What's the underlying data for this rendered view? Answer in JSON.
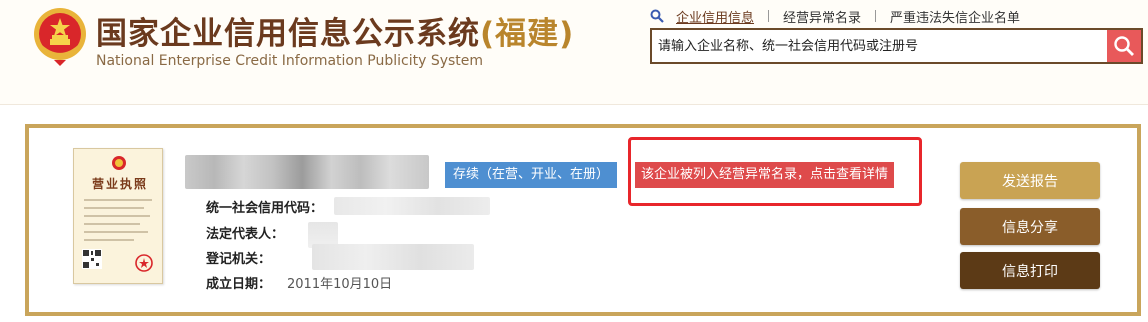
{
  "header": {
    "title_cn": "国家企业信用信息公示系统",
    "province": "(福建)",
    "title_en": "National Enterprise Credit Information Publicity System"
  },
  "nav": {
    "items": [
      "企业信用信息",
      "经营异常名录",
      "严重违法失信企业名单"
    ]
  },
  "search": {
    "placeholder": "请输入企业名称、统一社会信用代码或注册号"
  },
  "result": {
    "license_title": "营业执照",
    "status": "存续（在营、开业、在册）",
    "abnormal_notice": "该企业被列入经营异常名录，点击查看详情",
    "fields": {
      "credit_code_label": "统一社会信用代码：",
      "legal_rep_label": "法定代表人：",
      "registry_label": "登记机关：",
      "established_label": "成立日期：",
      "established_value": "2011年10月10日"
    }
  },
  "actions": {
    "send_report": "发送报告",
    "share": "信息分享",
    "print": "信息打印"
  },
  "colors": {
    "brand_brown": "#6b3a1e",
    "gold": "#c9a55b",
    "status_blue": "#4e8fd1",
    "alert_red": "#de4a4b"
  }
}
